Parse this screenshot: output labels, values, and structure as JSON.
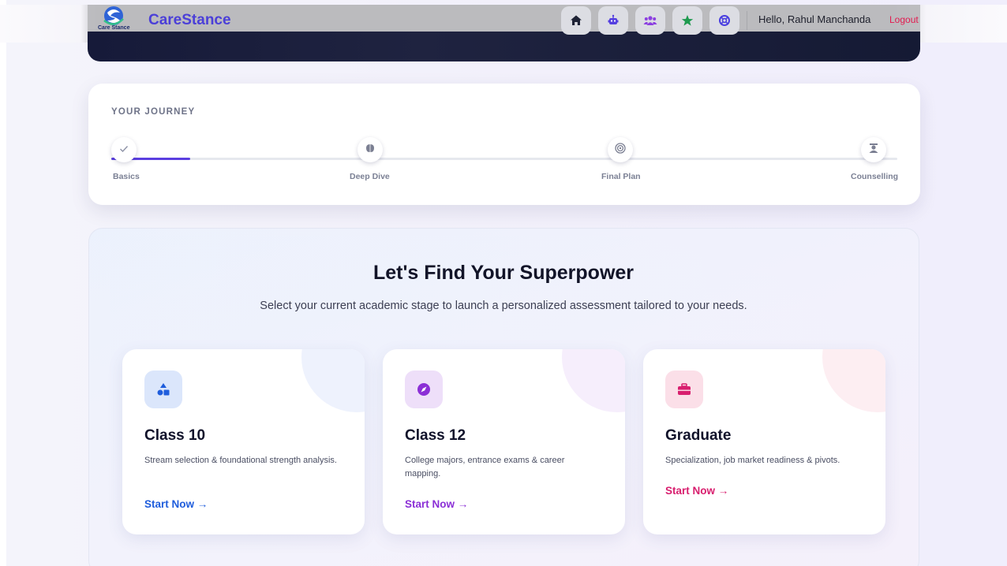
{
  "header": {
    "brand": "CareStance",
    "logo_caption": "Care Stance",
    "greeting": "Hello, Rahul Manchanda",
    "logout": "Logout",
    "nav_icons": [
      "home-icon",
      "robot-icon",
      "users-icon",
      "star-icon",
      "lifebuoy-icon"
    ]
  },
  "journey": {
    "title": "YOUR JOURNEY",
    "progress": 0.1,
    "steps": [
      {
        "label": "Basics",
        "icon": "check-icon"
      },
      {
        "label": "Deep Dive",
        "icon": "brain-icon"
      },
      {
        "label": "Final Plan",
        "icon": "target-icon"
      },
      {
        "label": "Counselling",
        "icon": "counsellor-icon"
      }
    ]
  },
  "main": {
    "headline": "Let's Find Your Superpower",
    "subline": "Select your current academic stage to launch a personalized assessment tailored to your needs.",
    "cards": [
      {
        "title": "Class 10",
        "description": "Stream selection & foundational strength analysis.",
        "cta": "Start Now →",
        "icon": "shapes-icon",
        "accent": "#1f5ddc"
      },
      {
        "title": "Class 12",
        "description": "College majors, entrance exams & career mapping.",
        "cta": "Start Now →",
        "icon": "compass-icon",
        "accent": "#8b2fd6"
      },
      {
        "title": "Graduate",
        "description": "Specialization, job market readiness & pivots.",
        "cta": "Start Now →",
        "icon": "briefcase-icon",
        "accent": "#d81e6e"
      }
    ]
  }
}
